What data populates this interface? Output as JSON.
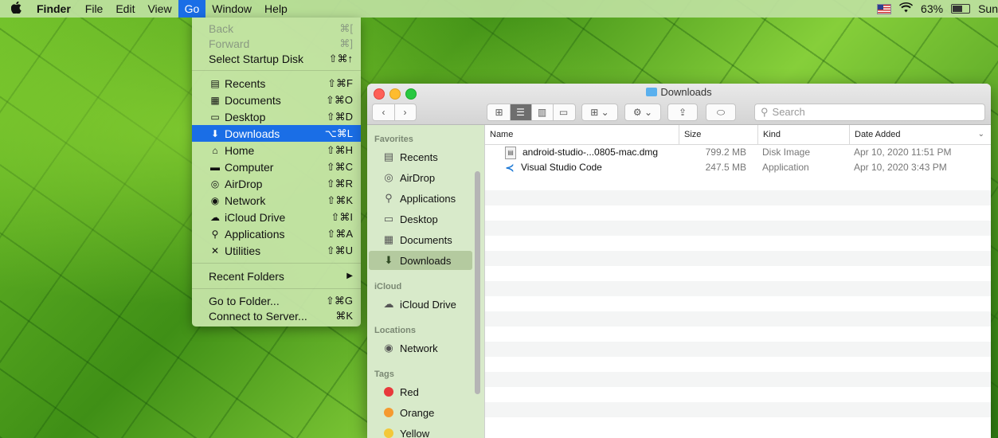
{
  "menubar": {
    "apple": "",
    "app": "Finder",
    "items": [
      "File",
      "Edit",
      "View",
      "Go",
      "Window",
      "Help"
    ],
    "battery": "63%",
    "clock": "Sun"
  },
  "go_menu": {
    "back": {
      "label": "Back",
      "shortcut": "⌘["
    },
    "forward": {
      "label": "Forward",
      "shortcut": "⌘]"
    },
    "startup": {
      "label": "Select Startup Disk",
      "shortcut": "⇧⌘↑"
    },
    "places": [
      {
        "label": "Recents",
        "shortcut": "⇧⌘F",
        "icon": "recents-icon"
      },
      {
        "label": "Documents",
        "shortcut": "⇧⌘O",
        "icon": "documents-icon"
      },
      {
        "label": "Desktop",
        "shortcut": "⇧⌘D",
        "icon": "desktop-icon"
      },
      {
        "label": "Downloads",
        "shortcut": "⌥⌘L",
        "icon": "downloads-icon"
      },
      {
        "label": "Home",
        "shortcut": "⇧⌘H",
        "icon": "home-icon"
      },
      {
        "label": "Computer",
        "shortcut": "⇧⌘C",
        "icon": "computer-icon"
      },
      {
        "label": "AirDrop",
        "shortcut": "⇧⌘R",
        "icon": "airdrop-icon"
      },
      {
        "label": "Network",
        "shortcut": "⇧⌘K",
        "icon": "network-icon"
      },
      {
        "label": "iCloud Drive",
        "shortcut": "⇧⌘I",
        "icon": "cloud-icon"
      },
      {
        "label": "Applications",
        "shortcut": "⇧⌘A",
        "icon": "applications-icon"
      },
      {
        "label": "Utilities",
        "shortcut": "⇧⌘U",
        "icon": "utilities-icon"
      }
    ],
    "recent_folders": "Recent Folders",
    "goto_folder": {
      "label": "Go to Folder...",
      "shortcut": "⇧⌘G"
    },
    "connect": {
      "label": "Connect to Server...",
      "shortcut": "⌘K"
    }
  },
  "window": {
    "title": "Downloads",
    "search_placeholder": "Search",
    "sidebar": {
      "favorites_header": "Favorites",
      "favorites": [
        "Recents",
        "AirDrop",
        "Applications",
        "Desktop",
        "Documents",
        "Downloads"
      ],
      "icloud_header": "iCloud",
      "icloud": [
        "iCloud Drive"
      ],
      "locations_header": "Locations",
      "locations": [
        "Network"
      ],
      "tags_header": "Tags",
      "tags": [
        {
          "label": "Red",
          "color": "#e8393b"
        },
        {
          "label": "Orange",
          "color": "#f59a2f"
        },
        {
          "label": "Yellow",
          "color": "#f3c83a"
        }
      ]
    },
    "columns": [
      "Name",
      "Size",
      "Kind",
      "Date Added"
    ],
    "files": [
      {
        "name": "android-studio-...0805-mac.dmg",
        "size": "799.2 MB",
        "kind": "Disk Image",
        "date": "Apr 10, 2020 11:51 PM",
        "icon": "dmg-icon"
      },
      {
        "name": "Visual Studio Code",
        "size": "247.5 MB",
        "kind": "Application",
        "date": "Apr 10, 2020 3:43 PM",
        "icon": "vscode-icon"
      }
    ]
  }
}
